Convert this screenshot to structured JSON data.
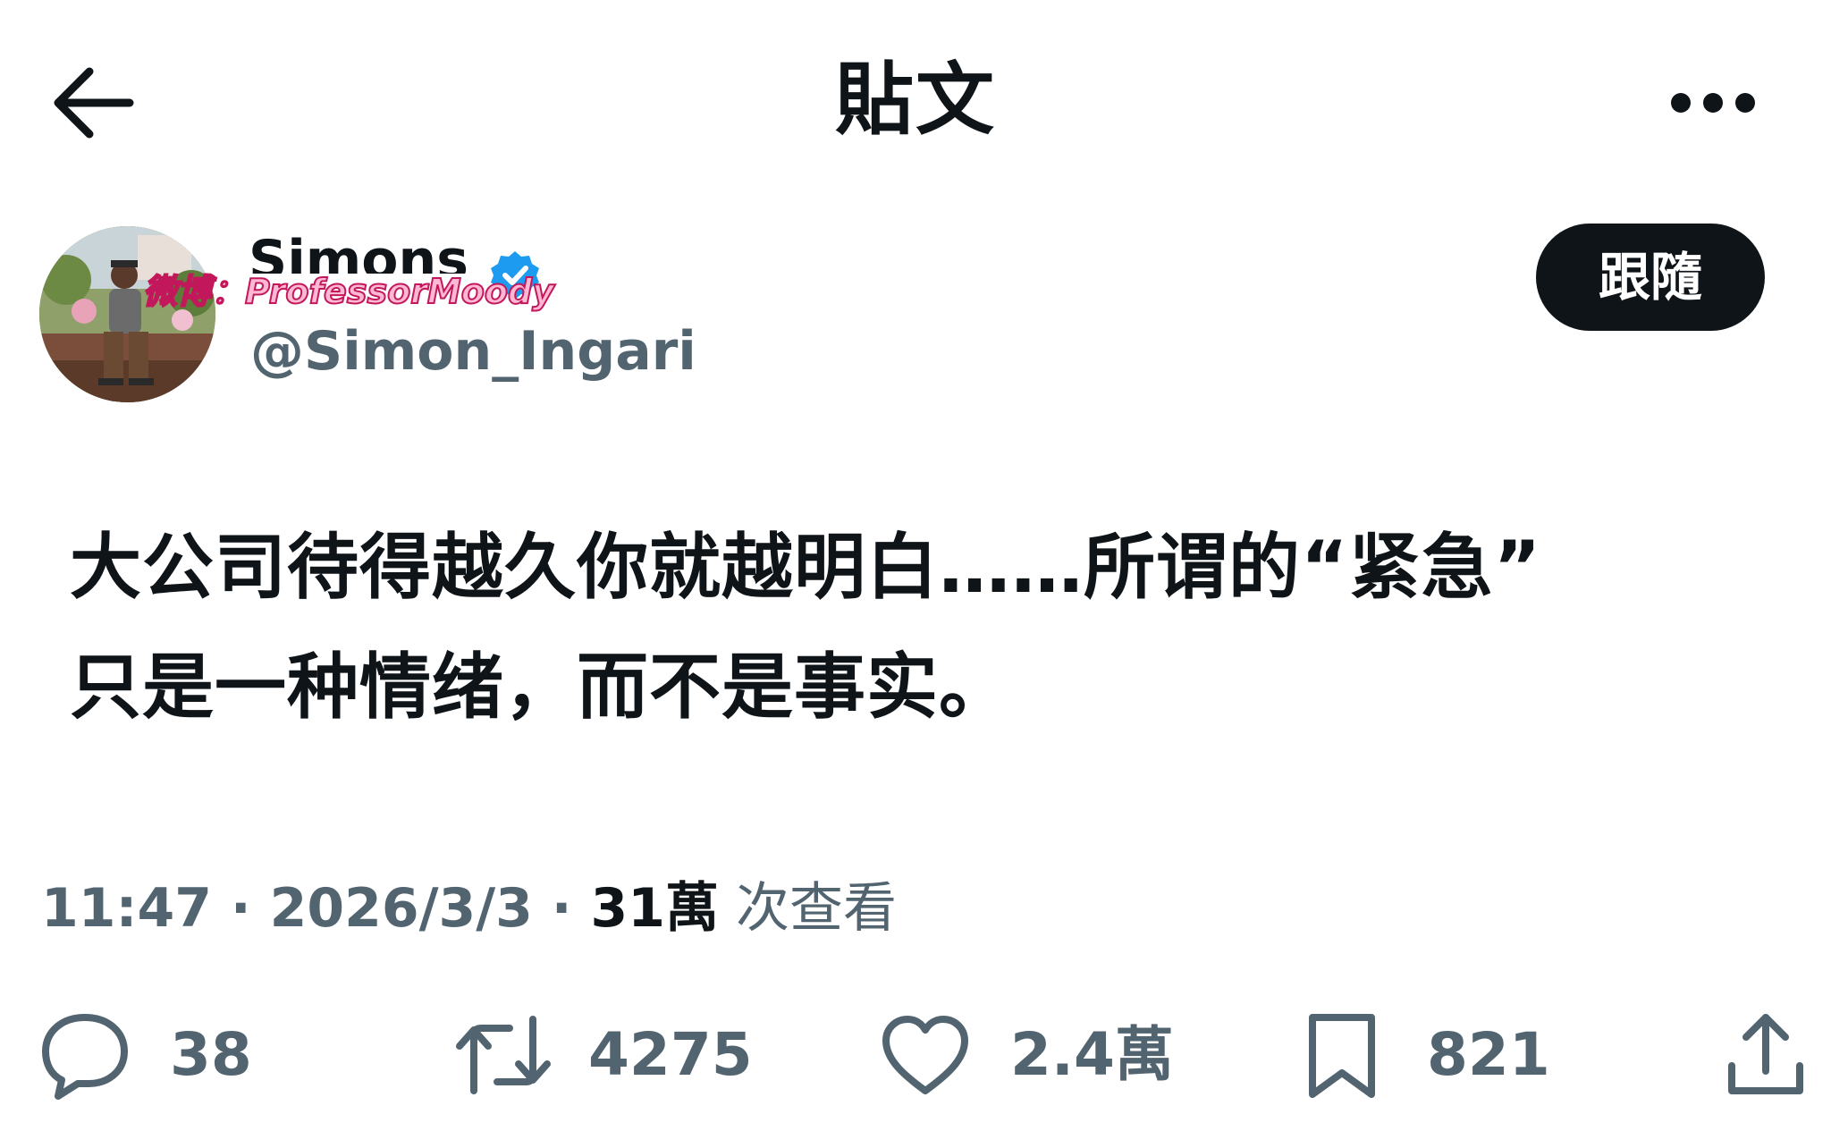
{
  "header": {
    "title": "貼文"
  },
  "author": {
    "display_name": "Simons",
    "handle": "@Simon_Ingari",
    "watermark": "微博：ProfessorMoody",
    "follow_label": "跟隨"
  },
  "tweet": {
    "line1": "大公司待得越久你就越明白……所谓的“紧急”",
    "line2": "只是一种情绪，而不是事实。"
  },
  "meta": {
    "time": "11:47",
    "separator": " · ",
    "date": "2026/3/3",
    "views_count": "31萬",
    "views_label": " 次查看"
  },
  "actions": {
    "replies": "38",
    "reposts": "4275",
    "likes": "2.4萬",
    "bookmarks": "821"
  },
  "colors": {
    "text_primary": "#0f1419",
    "text_secondary": "#536471",
    "verified": "#1d9bf0",
    "follow_bg": "#0f1419"
  }
}
